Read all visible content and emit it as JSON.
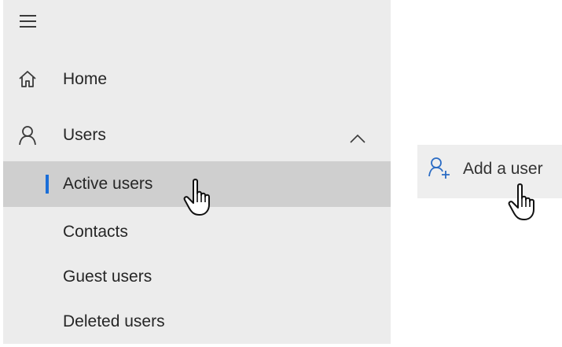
{
  "nav": {
    "menu_icon": "hamburger-menu-icon",
    "items": [
      {
        "label": "Home",
        "icon": "home-icon"
      },
      {
        "label": "Users",
        "icon": "person-icon",
        "expanded": true,
        "chevron_icon": "chevron-up-icon"
      }
    ],
    "users_submenu": [
      {
        "label": "Active users",
        "active": true
      },
      {
        "label": "Contacts"
      },
      {
        "label": "Guest users"
      },
      {
        "label": "Deleted users"
      }
    ]
  },
  "actions": {
    "add_user": {
      "label": "Add a user",
      "icon": "add-person-icon"
    }
  },
  "cursors": [
    "hand-pointer-cursor",
    "hand-pointer-cursor"
  ],
  "colors": {
    "panel_background": "#ececec",
    "active_row_background": "#cfcfcf",
    "active_indicator": "#1a6ed8",
    "accent_icon": "#2b6cc4",
    "text": "#262626"
  }
}
